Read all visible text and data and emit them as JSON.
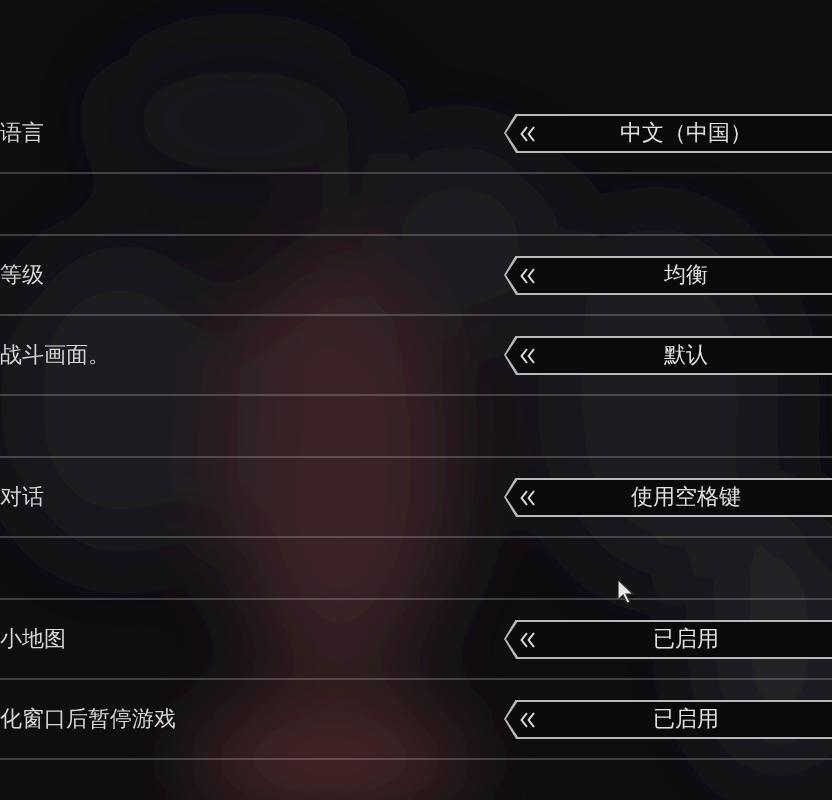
{
  "groups": [
    {
      "rows": [
        {
          "label": "语言",
          "value": "中文（中国）"
        }
      ]
    },
    {
      "rows": [
        {
          "label": "等级",
          "value": "均衡"
        },
        {
          "label": "战斗画面。",
          "value": "默认"
        }
      ]
    },
    {
      "rows": [
        {
          "label": "对话",
          "value": "使用空格键"
        }
      ]
    },
    {
      "rows": [
        {
          "label": "小地图",
          "value": "已启用"
        },
        {
          "label": "化窗口后暂停游戏",
          "value": "已启用"
        }
      ]
    }
  ]
}
